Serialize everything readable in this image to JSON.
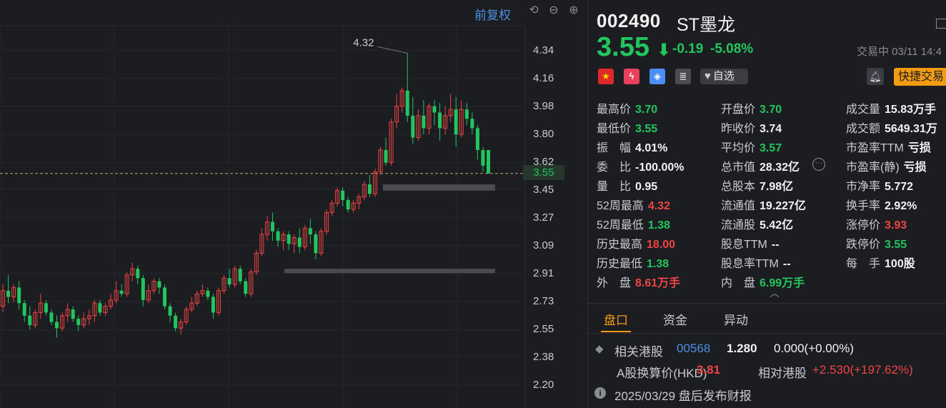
{
  "toolbar": {
    "restore_label": "前复权",
    "icons": [
      "undo-icon",
      "zoom-out-icon",
      "zoom-in-icon"
    ]
  },
  "chart_data": {
    "type": "candlestick",
    "y_ticks": [
      "4.34",
      "4.16",
      "3.98",
      "3.80",
      "3.62",
      "3.45",
      "3.27",
      "3.09",
      "2.91",
      "2.73",
      "2.55",
      "2.38",
      "2.20"
    ],
    "ylim": [
      2.12,
      4.42
    ],
    "current_price": "3.55",
    "high_annotation": "4.32",
    "candles": [
      [
        2.7,
        2.8,
        2.66,
        2.84
      ],
      [
        2.8,
        2.76,
        2.72,
        2.9
      ],
      [
        2.76,
        2.82,
        2.73,
        2.84
      ],
      [
        2.82,
        2.72,
        2.68,
        2.86
      ],
      [
        2.72,
        2.64,
        2.6,
        2.74
      ],
      [
        2.64,
        2.58,
        2.55,
        2.7
      ],
      [
        2.58,
        2.66,
        2.56,
        2.68
      ],
      [
        2.66,
        2.72,
        2.62,
        2.78
      ],
      [
        2.72,
        2.66,
        2.64,
        2.74
      ],
      [
        2.66,
        2.6,
        2.58,
        2.68
      ],
      [
        2.6,
        2.56,
        2.5,
        2.64
      ],
      [
        2.56,
        2.64,
        2.54,
        2.66
      ],
      [
        2.64,
        2.68,
        2.6,
        2.72
      ],
      [
        2.68,
        2.62,
        2.6,
        2.7
      ],
      [
        2.62,
        2.58,
        2.54,
        2.64
      ],
      [
        2.58,
        2.62,
        2.56,
        2.66
      ],
      [
        2.62,
        2.64,
        2.58,
        2.68
      ],
      [
        2.64,
        2.72,
        2.6,
        2.74
      ],
      [
        2.72,
        2.66,
        2.64,
        2.74
      ],
      [
        2.66,
        2.7,
        2.64,
        2.72
      ],
      [
        2.7,
        2.74,
        2.68,
        2.78
      ],
      [
        2.74,
        2.8,
        2.72,
        2.86
      ],
      [
        2.8,
        2.78,
        2.76,
        2.84
      ],
      [
        2.78,
        2.9,
        2.76,
        2.92
      ],
      [
        2.9,
        2.94,
        2.86,
        2.98
      ],
      [
        2.94,
        2.88,
        2.84,
        2.96
      ],
      [
        2.88,
        2.74,
        2.7,
        2.9
      ],
      [
        2.74,
        2.8,
        2.72,
        2.84
      ],
      [
        2.8,
        2.86,
        2.78,
        2.88
      ],
      [
        2.86,
        2.82,
        2.78,
        2.88
      ],
      [
        2.82,
        2.7,
        2.68,
        2.84
      ],
      [
        2.7,
        2.64,
        2.6,
        2.72
      ],
      [
        2.64,
        2.56,
        2.54,
        2.66
      ],
      [
        2.56,
        2.6,
        2.52,
        2.62
      ],
      [
        2.6,
        2.68,
        2.58,
        2.7
      ],
      [
        2.68,
        2.72,
        2.66,
        2.76
      ],
      [
        2.72,
        2.78,
        2.7,
        2.8
      ],
      [
        2.78,
        2.8,
        2.76,
        2.84
      ],
      [
        2.8,
        2.76,
        2.74,
        2.82
      ],
      [
        2.76,
        2.66,
        2.62,
        2.78
      ],
      [
        2.66,
        2.8,
        2.64,
        2.82
      ],
      [
        2.8,
        2.88,
        2.78,
        2.9
      ],
      [
        2.88,
        2.84,
        2.82,
        2.94
      ],
      [
        2.84,
        2.94,
        2.82,
        2.96
      ],
      [
        2.94,
        2.86,
        2.84,
        2.96
      ],
      [
        2.86,
        2.78,
        2.76,
        2.88
      ],
      [
        2.78,
        2.92,
        2.76,
        2.94
      ],
      [
        2.92,
        3.04,
        2.9,
        3.06
      ],
      [
        3.04,
        3.16,
        3.02,
        3.2
      ],
      [
        3.16,
        3.24,
        3.12,
        3.28
      ],
      [
        3.24,
        3.18,
        3.12,
        3.3
      ],
      [
        3.18,
        3.12,
        3.08,
        3.2
      ],
      [
        3.12,
        3.16,
        3.06,
        3.18
      ],
      [
        3.16,
        3.1,
        3.06,
        3.18
      ],
      [
        3.1,
        3.14,
        3.04,
        3.16
      ],
      [
        3.14,
        3.08,
        3.04,
        3.2
      ],
      [
        3.08,
        3.2,
        3.06,
        3.22
      ],
      [
        3.2,
        3.16,
        3.1,
        3.26
      ],
      [
        3.16,
        3.04,
        3.0,
        3.18
      ],
      [
        3.04,
        3.18,
        3.02,
        3.2
      ],
      [
        3.18,
        3.3,
        3.16,
        3.32
      ],
      [
        3.3,
        3.36,
        3.28,
        3.38
      ],
      [
        3.36,
        3.44,
        3.34,
        3.46
      ],
      [
        3.44,
        3.38,
        3.34,
        3.46
      ],
      [
        3.38,
        3.32,
        3.3,
        3.4
      ],
      [
        3.32,
        3.36,
        3.3,
        3.38
      ],
      [
        3.36,
        3.4,
        3.32,
        3.42
      ],
      [
        3.4,
        3.48,
        3.38,
        3.5
      ],
      [
        3.48,
        3.42,
        3.4,
        3.54
      ],
      [
        3.42,
        3.56,
        3.4,
        3.58
      ],
      [
        3.56,
        3.7,
        3.54,
        3.72
      ],
      [
        3.7,
        3.62,
        3.6,
        3.78
      ],
      [
        3.62,
        3.88,
        3.6,
        3.9
      ],
      [
        3.88,
        3.98,
        3.84,
        4.06
      ],
      [
        3.98,
        4.08,
        3.94,
        4.1
      ],
      [
        4.08,
        3.92,
        3.88,
        4.32
      ],
      [
        3.92,
        3.78,
        3.74,
        4.04
      ],
      [
        3.78,
        3.92,
        3.76,
        3.96
      ],
      [
        3.92,
        3.84,
        3.8,
        4.02
      ],
      [
        3.84,
        3.98,
        3.8,
        4.0
      ],
      [
        3.98,
        3.94,
        3.86,
        4.02
      ],
      [
        3.94,
        3.84,
        3.76,
        4.0
      ],
      [
        3.84,
        3.92,
        3.8,
        3.98
      ],
      [
        3.92,
        3.96,
        3.88,
        4.06
      ],
      [
        3.96,
        3.8,
        3.72,
        4.04
      ],
      [
        3.8,
        3.96,
        3.78,
        4.02
      ],
      [
        3.96,
        3.9,
        3.86,
        4.0
      ],
      [
        3.9,
        3.84,
        3.8,
        3.94
      ],
      [
        3.84,
        3.7,
        3.64,
        3.86
      ],
      [
        3.7,
        3.6,
        3.56,
        3.72
      ],
      [
        3.7,
        3.55,
        3.55,
        3.7
      ]
    ],
    "support_bands": [
      [
        3.48,
        3.44
      ],
      [
        2.94,
        2.92
      ]
    ]
  },
  "quote": {
    "code": "002490",
    "name": "ST墨龙",
    "price": "3.55",
    "change": "-0.19",
    "change_pct": "-5.08%",
    "status": "交易中 03/11 14:4",
    "favorite_label": "自选",
    "trade_label": "快捷交易",
    "colors": {
      "up": "#ef4444",
      "down": "#22c55e",
      "accent": "#f39c12",
      "link": "#4a90e2"
    }
  },
  "stats": [
    {
      "k": "最高价",
      "v": "3.70",
      "c": "g"
    },
    {
      "k": "开盘价",
      "v": "3.70",
      "c": "g"
    },
    {
      "k": "成交量",
      "v": "15.83万手",
      "c": "w"
    },
    {
      "k": "最低价",
      "v": "3.55",
      "c": "g"
    },
    {
      "k": "昨收价",
      "v": "3.74",
      "c": "w"
    },
    {
      "k": "成交额",
      "v": "5649.31万",
      "c": "w"
    },
    {
      "k": "振　幅",
      "v": "4.01%",
      "c": "w"
    },
    {
      "k": "平均价",
      "v": "3.57",
      "c": "g"
    },
    {
      "k": "市盈率TTM",
      "v": "亏损",
      "c": "w"
    },
    {
      "k": "委　比",
      "v": "-100.00%",
      "c": "w"
    },
    {
      "k": "总市值",
      "v": "28.32亿",
      "c": "w"
    },
    {
      "k": "市盈率(静)",
      "v": "亏损",
      "c": "w"
    },
    {
      "k": "量　比",
      "v": "0.95",
      "c": "w"
    },
    {
      "k": "总股本",
      "v": "7.98亿",
      "c": "w"
    },
    {
      "k": "市净率",
      "v": "5.772",
      "c": "w"
    },
    {
      "k": "52周最高",
      "v": "4.32",
      "c": "r"
    },
    {
      "k": "流通值",
      "v": "19.227亿",
      "c": "w"
    },
    {
      "k": "换手率",
      "v": "2.92%",
      "c": "w"
    },
    {
      "k": "52周最低",
      "v": "1.38",
      "c": "g"
    },
    {
      "k": "流通股",
      "v": "5.42亿",
      "c": "w"
    },
    {
      "k": "涨停价",
      "v": "3.93",
      "c": "r"
    },
    {
      "k": "历史最高",
      "v": "18.00",
      "c": "r"
    },
    {
      "k": "股息TTM",
      "v": "--",
      "c": "w"
    },
    {
      "k": "跌停价",
      "v": "3.55",
      "c": "g"
    },
    {
      "k": "历史最低",
      "v": "1.38",
      "c": "g"
    },
    {
      "k": "股息率TTM",
      "v": "--",
      "c": "w"
    },
    {
      "k": "每　手",
      "v": "100股",
      "c": "w"
    },
    {
      "k": "外　盘",
      "v": "8.61万手",
      "c": "r"
    },
    {
      "k": "内　盘",
      "v": "6.99万手",
      "c": "g"
    }
  ],
  "tabs": [
    {
      "label": "盘口",
      "active": true
    },
    {
      "label": "资金",
      "active": false
    },
    {
      "label": "异动",
      "active": false
    }
  ],
  "hk": {
    "label": "相关港股",
    "code": "00568",
    "price": "1.280",
    "change": "0.000(+0.00%)",
    "conv_label": "A股换算价(HKD)",
    "conv_value": "3.81",
    "rel_label": "相对港股",
    "rel_value": "+2.530(+197.62%)"
  },
  "notice": "2025/03/29  盘后发布财报"
}
